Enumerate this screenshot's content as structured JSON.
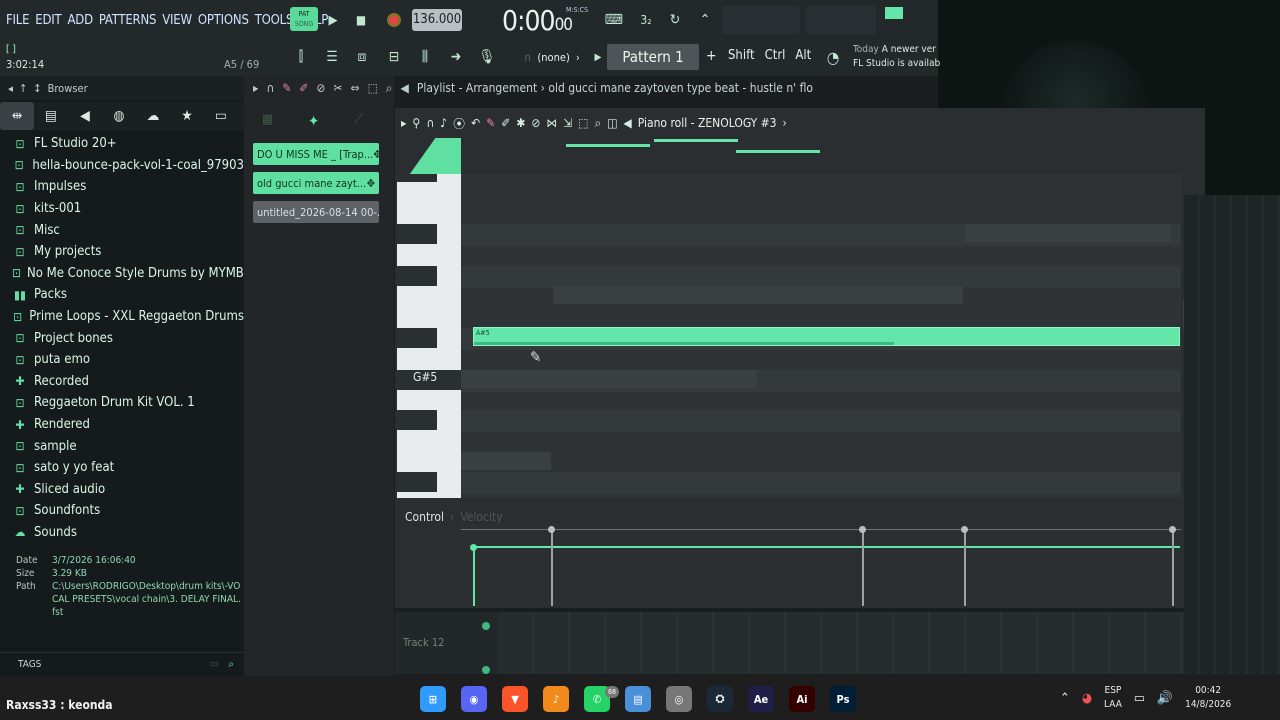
{
  "menu": [
    "FILE",
    "EDIT",
    "ADD",
    "PATTERNS",
    "VIEW",
    "OPTIONS",
    "TOOLS",
    "HELP"
  ],
  "transport": {
    "pat_label": "PAT",
    "song_label": "SONG",
    "tempo": "136.000",
    "time_big": "0:00",
    "time_small": "00",
    "time_unit": "M:S:CS",
    "beat_label": "3₂"
  },
  "row2": {
    "hint": "[ ]",
    "cursor_time": "3:02:14",
    "key_pos": "A5 / 69",
    "none_label": "(none)",
    "pattern": "Pattern 1",
    "plus": "+",
    "mods": [
      "Shift",
      "Ctrl",
      "Alt"
    ],
    "news_line1_a": "Today",
    "news_line1_b": "A newer ver",
    "news_line2": "FL Studio is availab"
  },
  "browser": {
    "title": "Browser",
    "toolbar_icons": [
      "browser-plugins-icon",
      "file-icon",
      "speaker-icon",
      "globe-icon",
      "cloud-icon",
      "star-icon",
      "folder-icon"
    ],
    "items": [
      {
        "label": "FL Studio 20+",
        "icon": "folder"
      },
      {
        "label": "hella-bounce-pack-vol-1-coal_97903",
        "icon": "folder"
      },
      {
        "label": "Impulses",
        "icon": "folder"
      },
      {
        "label": "kits-001",
        "icon": "folder"
      },
      {
        "label": "Misc",
        "icon": "folder"
      },
      {
        "label": "My projects",
        "icon": "folder"
      },
      {
        "label": "No Me Conoce Style Drums by MYMBA",
        "icon": "folder"
      },
      {
        "label": "Packs",
        "icon": "packs"
      },
      {
        "label": "Prime Loops - XXL Reggaeton Drums",
        "icon": "folder"
      },
      {
        "label": "Project bones",
        "icon": "folder"
      },
      {
        "label": "puta emo",
        "icon": "folder"
      },
      {
        "label": "Recorded",
        "icon": "plus"
      },
      {
        "label": "Reggaeton Drum Kit VOL. 1",
        "icon": "folder"
      },
      {
        "label": "Rendered",
        "icon": "plus"
      },
      {
        "label": "sample",
        "icon": "folder"
      },
      {
        "label": "sato y yo feat",
        "icon": "folder"
      },
      {
        "label": "Sliced audio",
        "icon": "plus"
      },
      {
        "label": "Soundfonts",
        "icon": "folder"
      },
      {
        "label": "Sounds",
        "icon": "cloud"
      }
    ],
    "info": {
      "date_key": "Date",
      "date": "3/7/2026 16:06:40",
      "size_key": "Size",
      "size": "3.29 KB",
      "path_key": "Path",
      "path": "C:\\Users\\RODRIGO\\Desktop\\drum kits\\-VOCAL PRESETS\\vocal chain\\3. DELAY FINAL.fst"
    },
    "tags_label": "TAGS"
  },
  "playlist": {
    "header": "Playlist - Arrangement › old gucci mane  zaytoven type beat - hustle n' flo",
    "clips": [
      {
        "label": "DO U MISS ME _ [Trap...",
        "active": true
      },
      {
        "label": "old gucci mane  zayt...",
        "active": true
      },
      {
        "label": "untitled_2026-08-14 00-...",
        "active": false
      }
    ]
  },
  "piano_roll": {
    "title": "Piano roll - ZENOLOGY #3",
    "note_label": "A#5",
    "key_label": "G#5",
    "control_label": "Control",
    "control_target": "Velocity",
    "track_label": "Track 12"
  },
  "taskbar": {
    "user": "Raxss33 : keonda",
    "apps": [
      {
        "name": "windows-start-icon",
        "color": "#2f9bff",
        "glyph": "⊞"
      },
      {
        "name": "discord-icon",
        "color": "#5865f2",
        "glyph": "◉"
      },
      {
        "name": "brave-icon",
        "color": "#fb542b",
        "glyph": "▼"
      },
      {
        "name": "fl-studio-icon",
        "color": "#f28a1b",
        "glyph": "♪"
      },
      {
        "name": "whatsapp-icon",
        "color": "#25d366",
        "glyph": "✆"
      },
      {
        "name": "notepad-icon",
        "color": "#4a90d9",
        "glyph": "▤"
      },
      {
        "name": "chrome-icon",
        "color": "#777",
        "glyph": "◎"
      },
      {
        "name": "steam-icon",
        "color": "#1b2838",
        "glyph": "⛭"
      },
      {
        "name": "after-effects-icon",
        "color": "#1f1f4a",
        "glyph": "Ae"
      },
      {
        "name": "illustrator-icon",
        "color": "#330000",
        "glyph": "Ai"
      },
      {
        "name": "photoshop-icon",
        "color": "#001e36",
        "glyph": "Ps"
      }
    ],
    "whatsapp_badge": "68",
    "lang_top": "ESP",
    "lang_bottom": "LAA",
    "time": "00:42",
    "date": "14/8/2026"
  }
}
